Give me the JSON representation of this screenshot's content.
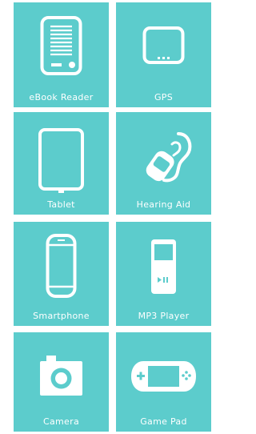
{
  "colors": {
    "tile_background": "#5ccccc",
    "icon_and_text": "#ffffff",
    "page_background": "#ffffff"
  },
  "devices": [
    {
      "label": "eBook Reader",
      "icon": "ebook-reader-icon"
    },
    {
      "label": "GPS",
      "icon": "gps-icon"
    },
    {
      "label": "Tablet",
      "icon": "tablet-icon"
    },
    {
      "label": "Hearing Aid",
      "icon": "hearing-aid-icon"
    },
    {
      "label": "Smartphone",
      "icon": "smartphone-icon"
    },
    {
      "label": "MP3 Player",
      "icon": "mp3-player-icon"
    },
    {
      "label": "Camera",
      "icon": "camera-icon"
    },
    {
      "label": "Game Pad",
      "icon": "game-pad-icon"
    }
  ]
}
